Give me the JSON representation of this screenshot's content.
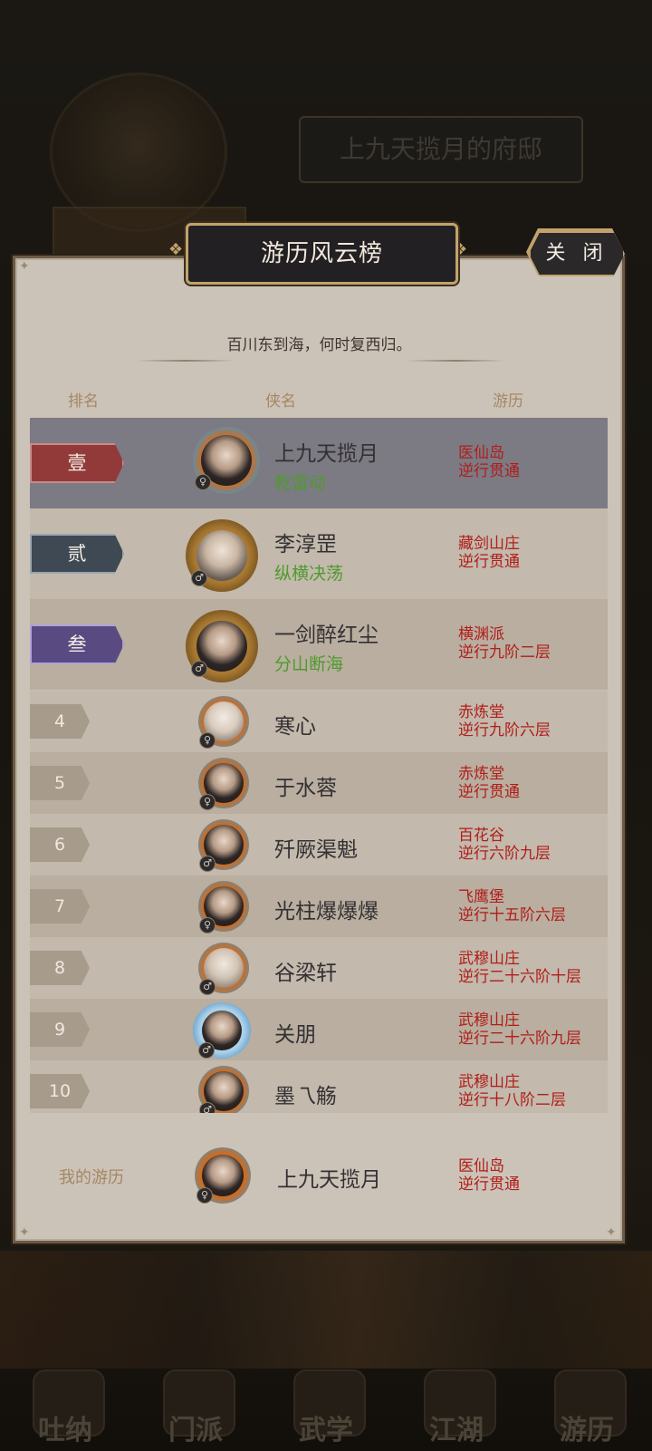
{
  "background": {
    "house_title": "上九天揽月的府邸",
    "nav": [
      "吐纳",
      "门派",
      "武学",
      "江湖",
      "游历"
    ]
  },
  "modal": {
    "title": "游历风云榜",
    "close_label": "关 闭",
    "subtitle": "百川东到海，何时复西归。",
    "headers": {
      "rank": "排名",
      "hero": "侠名",
      "travel": "游历"
    }
  },
  "ranking": [
    {
      "rank": "壹",
      "name": "上九天揽月",
      "skill": "乾雷动",
      "place": "医仙岛",
      "progress": "逆行贯通"
    },
    {
      "rank": "贰",
      "name": "李淳罡",
      "skill": "纵横决荡",
      "place": "藏剑山庄",
      "progress": "逆行贯通"
    },
    {
      "rank": "叁",
      "name": "一剑醉红尘",
      "skill": "分山断海",
      "place": "横渊派",
      "progress": "逆行九阶二层"
    },
    {
      "rank": "4",
      "name": "寒心",
      "place": "赤炼堂",
      "progress": "逆行九阶六层"
    },
    {
      "rank": "5",
      "name": "于水蓉",
      "place": "赤炼堂",
      "progress": "逆行贯通"
    },
    {
      "rank": "6",
      "name": "歼厥渠魁",
      "place": "百花谷",
      "progress": "逆行六阶九层"
    },
    {
      "rank": "7",
      "name": "光柱爆爆爆",
      "place": "飞鹰堡",
      "progress": "逆行十五阶六层"
    },
    {
      "rank": "8",
      "name": "谷梁轩",
      "place": "武穆山庄",
      "progress": "逆行二十六阶十层"
    },
    {
      "rank": "9",
      "name": "关朋",
      "place": "武穆山庄",
      "progress": "逆行二十六阶九层"
    },
    {
      "rank": "10",
      "name": "墨乁觞",
      "place": "武穆山庄",
      "progress": "逆行十八阶二层"
    }
  ],
  "mine": {
    "label": "我的游历",
    "name": "上九天揽月",
    "place": "医仙岛",
    "progress": "逆行贯通"
  },
  "colors": {
    "panel_bg": "#ccc3b8",
    "highlight_row": "#7c7a83",
    "rank1_badge": "#923a3a",
    "rank2_badge": "#3e4953",
    "rank3_badge": "#5a4a82",
    "skill_text": "#4f9a2f",
    "place_text": "#b11d1a",
    "gold_border": "#c2a36b"
  }
}
